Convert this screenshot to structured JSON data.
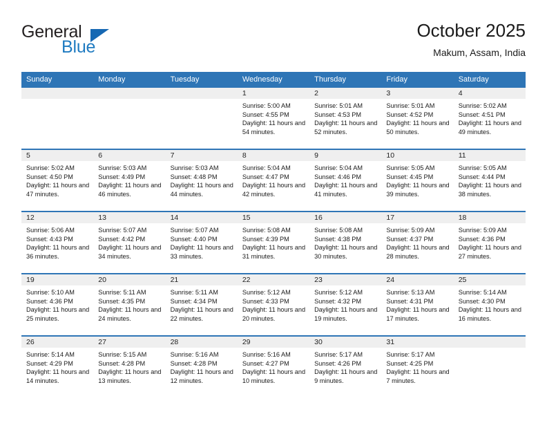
{
  "logo": {
    "word1": "General",
    "word2": "Blue",
    "accent_color": "#1668b3"
  },
  "header": {
    "title": "October 2025",
    "subtitle": "Makum, Assam, India"
  },
  "calendar": {
    "header_color": "#2e75b6",
    "weekdays": [
      "Sunday",
      "Monday",
      "Tuesday",
      "Wednesday",
      "Thursday",
      "Friday",
      "Saturday"
    ],
    "weeks": [
      [
        {
          "day": "",
          "sunrise": "",
          "sunset": "",
          "daylight": "",
          "empty": true
        },
        {
          "day": "",
          "sunrise": "",
          "sunset": "",
          "daylight": "",
          "empty": true
        },
        {
          "day": "",
          "sunrise": "",
          "sunset": "",
          "daylight": "",
          "empty": true
        },
        {
          "day": "1",
          "sunrise": "Sunrise: 5:00 AM",
          "sunset": "Sunset: 4:55 PM",
          "daylight": "Daylight: 11 hours and 54 minutes."
        },
        {
          "day": "2",
          "sunrise": "Sunrise: 5:01 AM",
          "sunset": "Sunset: 4:53 PM",
          "daylight": "Daylight: 11 hours and 52 minutes."
        },
        {
          "day": "3",
          "sunrise": "Sunrise: 5:01 AM",
          "sunset": "Sunset: 4:52 PM",
          "daylight": "Daylight: 11 hours and 50 minutes."
        },
        {
          "day": "4",
          "sunrise": "Sunrise: 5:02 AM",
          "sunset": "Sunset: 4:51 PM",
          "daylight": "Daylight: 11 hours and 49 minutes."
        }
      ],
      [
        {
          "day": "5",
          "sunrise": "Sunrise: 5:02 AM",
          "sunset": "Sunset: 4:50 PM",
          "daylight": "Daylight: 11 hours and 47 minutes."
        },
        {
          "day": "6",
          "sunrise": "Sunrise: 5:03 AM",
          "sunset": "Sunset: 4:49 PM",
          "daylight": "Daylight: 11 hours and 46 minutes."
        },
        {
          "day": "7",
          "sunrise": "Sunrise: 5:03 AM",
          "sunset": "Sunset: 4:48 PM",
          "daylight": "Daylight: 11 hours and 44 minutes."
        },
        {
          "day": "8",
          "sunrise": "Sunrise: 5:04 AM",
          "sunset": "Sunset: 4:47 PM",
          "daylight": "Daylight: 11 hours and 42 minutes."
        },
        {
          "day": "9",
          "sunrise": "Sunrise: 5:04 AM",
          "sunset": "Sunset: 4:46 PM",
          "daylight": "Daylight: 11 hours and 41 minutes."
        },
        {
          "day": "10",
          "sunrise": "Sunrise: 5:05 AM",
          "sunset": "Sunset: 4:45 PM",
          "daylight": "Daylight: 11 hours and 39 minutes."
        },
        {
          "day": "11",
          "sunrise": "Sunrise: 5:05 AM",
          "sunset": "Sunset: 4:44 PM",
          "daylight": "Daylight: 11 hours and 38 minutes."
        }
      ],
      [
        {
          "day": "12",
          "sunrise": "Sunrise: 5:06 AM",
          "sunset": "Sunset: 4:43 PM",
          "daylight": "Daylight: 11 hours and 36 minutes."
        },
        {
          "day": "13",
          "sunrise": "Sunrise: 5:07 AM",
          "sunset": "Sunset: 4:42 PM",
          "daylight": "Daylight: 11 hours and 34 minutes."
        },
        {
          "day": "14",
          "sunrise": "Sunrise: 5:07 AM",
          "sunset": "Sunset: 4:40 PM",
          "daylight": "Daylight: 11 hours and 33 minutes."
        },
        {
          "day": "15",
          "sunrise": "Sunrise: 5:08 AM",
          "sunset": "Sunset: 4:39 PM",
          "daylight": "Daylight: 11 hours and 31 minutes."
        },
        {
          "day": "16",
          "sunrise": "Sunrise: 5:08 AM",
          "sunset": "Sunset: 4:38 PM",
          "daylight": "Daylight: 11 hours and 30 minutes."
        },
        {
          "day": "17",
          "sunrise": "Sunrise: 5:09 AM",
          "sunset": "Sunset: 4:37 PM",
          "daylight": "Daylight: 11 hours and 28 minutes."
        },
        {
          "day": "18",
          "sunrise": "Sunrise: 5:09 AM",
          "sunset": "Sunset: 4:36 PM",
          "daylight": "Daylight: 11 hours and 27 minutes."
        }
      ],
      [
        {
          "day": "19",
          "sunrise": "Sunrise: 5:10 AM",
          "sunset": "Sunset: 4:36 PM",
          "daylight": "Daylight: 11 hours and 25 minutes."
        },
        {
          "day": "20",
          "sunrise": "Sunrise: 5:11 AM",
          "sunset": "Sunset: 4:35 PM",
          "daylight": "Daylight: 11 hours and 24 minutes."
        },
        {
          "day": "21",
          "sunrise": "Sunrise: 5:11 AM",
          "sunset": "Sunset: 4:34 PM",
          "daylight": "Daylight: 11 hours and 22 minutes."
        },
        {
          "day": "22",
          "sunrise": "Sunrise: 5:12 AM",
          "sunset": "Sunset: 4:33 PM",
          "daylight": "Daylight: 11 hours and 20 minutes."
        },
        {
          "day": "23",
          "sunrise": "Sunrise: 5:12 AM",
          "sunset": "Sunset: 4:32 PM",
          "daylight": "Daylight: 11 hours and 19 minutes."
        },
        {
          "day": "24",
          "sunrise": "Sunrise: 5:13 AM",
          "sunset": "Sunset: 4:31 PM",
          "daylight": "Daylight: 11 hours and 17 minutes."
        },
        {
          "day": "25",
          "sunrise": "Sunrise: 5:14 AM",
          "sunset": "Sunset: 4:30 PM",
          "daylight": "Daylight: 11 hours and 16 minutes."
        }
      ],
      [
        {
          "day": "26",
          "sunrise": "Sunrise: 5:14 AM",
          "sunset": "Sunset: 4:29 PM",
          "daylight": "Daylight: 11 hours and 14 minutes."
        },
        {
          "day": "27",
          "sunrise": "Sunrise: 5:15 AM",
          "sunset": "Sunset: 4:28 PM",
          "daylight": "Daylight: 11 hours and 13 minutes."
        },
        {
          "day": "28",
          "sunrise": "Sunrise: 5:16 AM",
          "sunset": "Sunset: 4:28 PM",
          "daylight": "Daylight: 11 hours and 12 minutes."
        },
        {
          "day": "29",
          "sunrise": "Sunrise: 5:16 AM",
          "sunset": "Sunset: 4:27 PM",
          "daylight": "Daylight: 11 hours and 10 minutes."
        },
        {
          "day": "30",
          "sunrise": "Sunrise: 5:17 AM",
          "sunset": "Sunset: 4:26 PM",
          "daylight": "Daylight: 11 hours and 9 minutes."
        },
        {
          "day": "31",
          "sunrise": "Sunrise: 5:17 AM",
          "sunset": "Sunset: 4:25 PM",
          "daylight": "Daylight: 11 hours and 7 minutes."
        },
        {
          "day": "",
          "sunrise": "",
          "sunset": "",
          "daylight": "",
          "empty": true
        }
      ]
    ]
  }
}
